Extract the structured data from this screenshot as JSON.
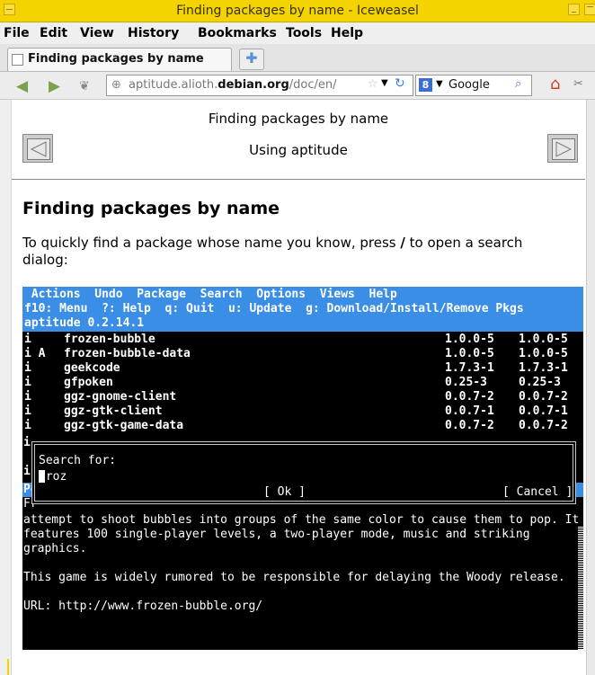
{
  "window": {
    "title": "Finding packages by name - Iceweasel"
  },
  "menu": {
    "file": "File",
    "edit": "Edit",
    "view": "View",
    "history": "History",
    "bookmarks": "Bookmarks",
    "tools": "Tools",
    "help": "Help"
  },
  "tab": {
    "label": "Finding packages by name"
  },
  "nav": {
    "url_prefix": "aptitude.alioth.",
    "url_domain": "debian.org",
    "url_suffix": "/doc/en/",
    "search_engine": "Google"
  },
  "page": {
    "top_title": "Finding packages by name",
    "chapter": "Using aptitude",
    "heading": "Finding packages by name",
    "para_before": "To quickly find a package whose name you know, press ",
    "para_key": "/",
    "para_after": " to open a search dialog:"
  },
  "terminal": {
    "menu_line": " Actions  Undo  Package  Search  Options  Views  Help",
    "help_line": "f10: Menu  ?: Help  q: Quit  u: Update  g: Download/Install/Remove Pkgs",
    "version_line": "aptitude 0.2.14.1",
    "packages": [
      {
        "flag": "i",
        "name": "frozen-bubble",
        "cur": "1.0.0-5",
        "avail": "1.0.0-5"
      },
      {
        "flag": "i A",
        "name": "frozen-bubble-data",
        "cur": "1.0.0-5",
        "avail": "1.0.0-5"
      },
      {
        "flag": "i",
        "name": "geekcode",
        "cur": "1.7.3-1",
        "avail": "1.7.3-1"
      },
      {
        "flag": "i",
        "name": "gfpoken",
        "cur": "0.25-3",
        "avail": "0.25-3"
      },
      {
        "flag": "i",
        "name": "ggz-gnome-client",
        "cur": "0.0.7-2",
        "avail": "0.0.7-2"
      },
      {
        "flag": "i",
        "name": "ggz-gtk-client",
        "cur": "0.0.7-1",
        "avail": "0.0.7-1"
      },
      {
        "flag": "i",
        "name": "ggz-gtk-game-data",
        "cur": "0.0.7-2",
        "avail": "0.0.7-2"
      }
    ],
    "dialog": {
      "label": "Search for:",
      "value": "froz",
      "ok": "[ Ok ]",
      "cancel": "[ Cancel ]"
    },
    "left_i1": "i",
    "left_i2": "i",
    "left_po": "Po",
    "left_fr": "Fr",
    "desc1": "attempt to shoot bubbles into groups of the same color to cause them to pop. It",
    "desc2": "features 100 single-player levels, a two-player mode, music and striking",
    "desc3": "graphics.",
    "desc4": "This game is widely rumored to be responsible for delaying the Woody release.",
    "desc5": "URL: http://www.frozen-bubble.org/"
  }
}
